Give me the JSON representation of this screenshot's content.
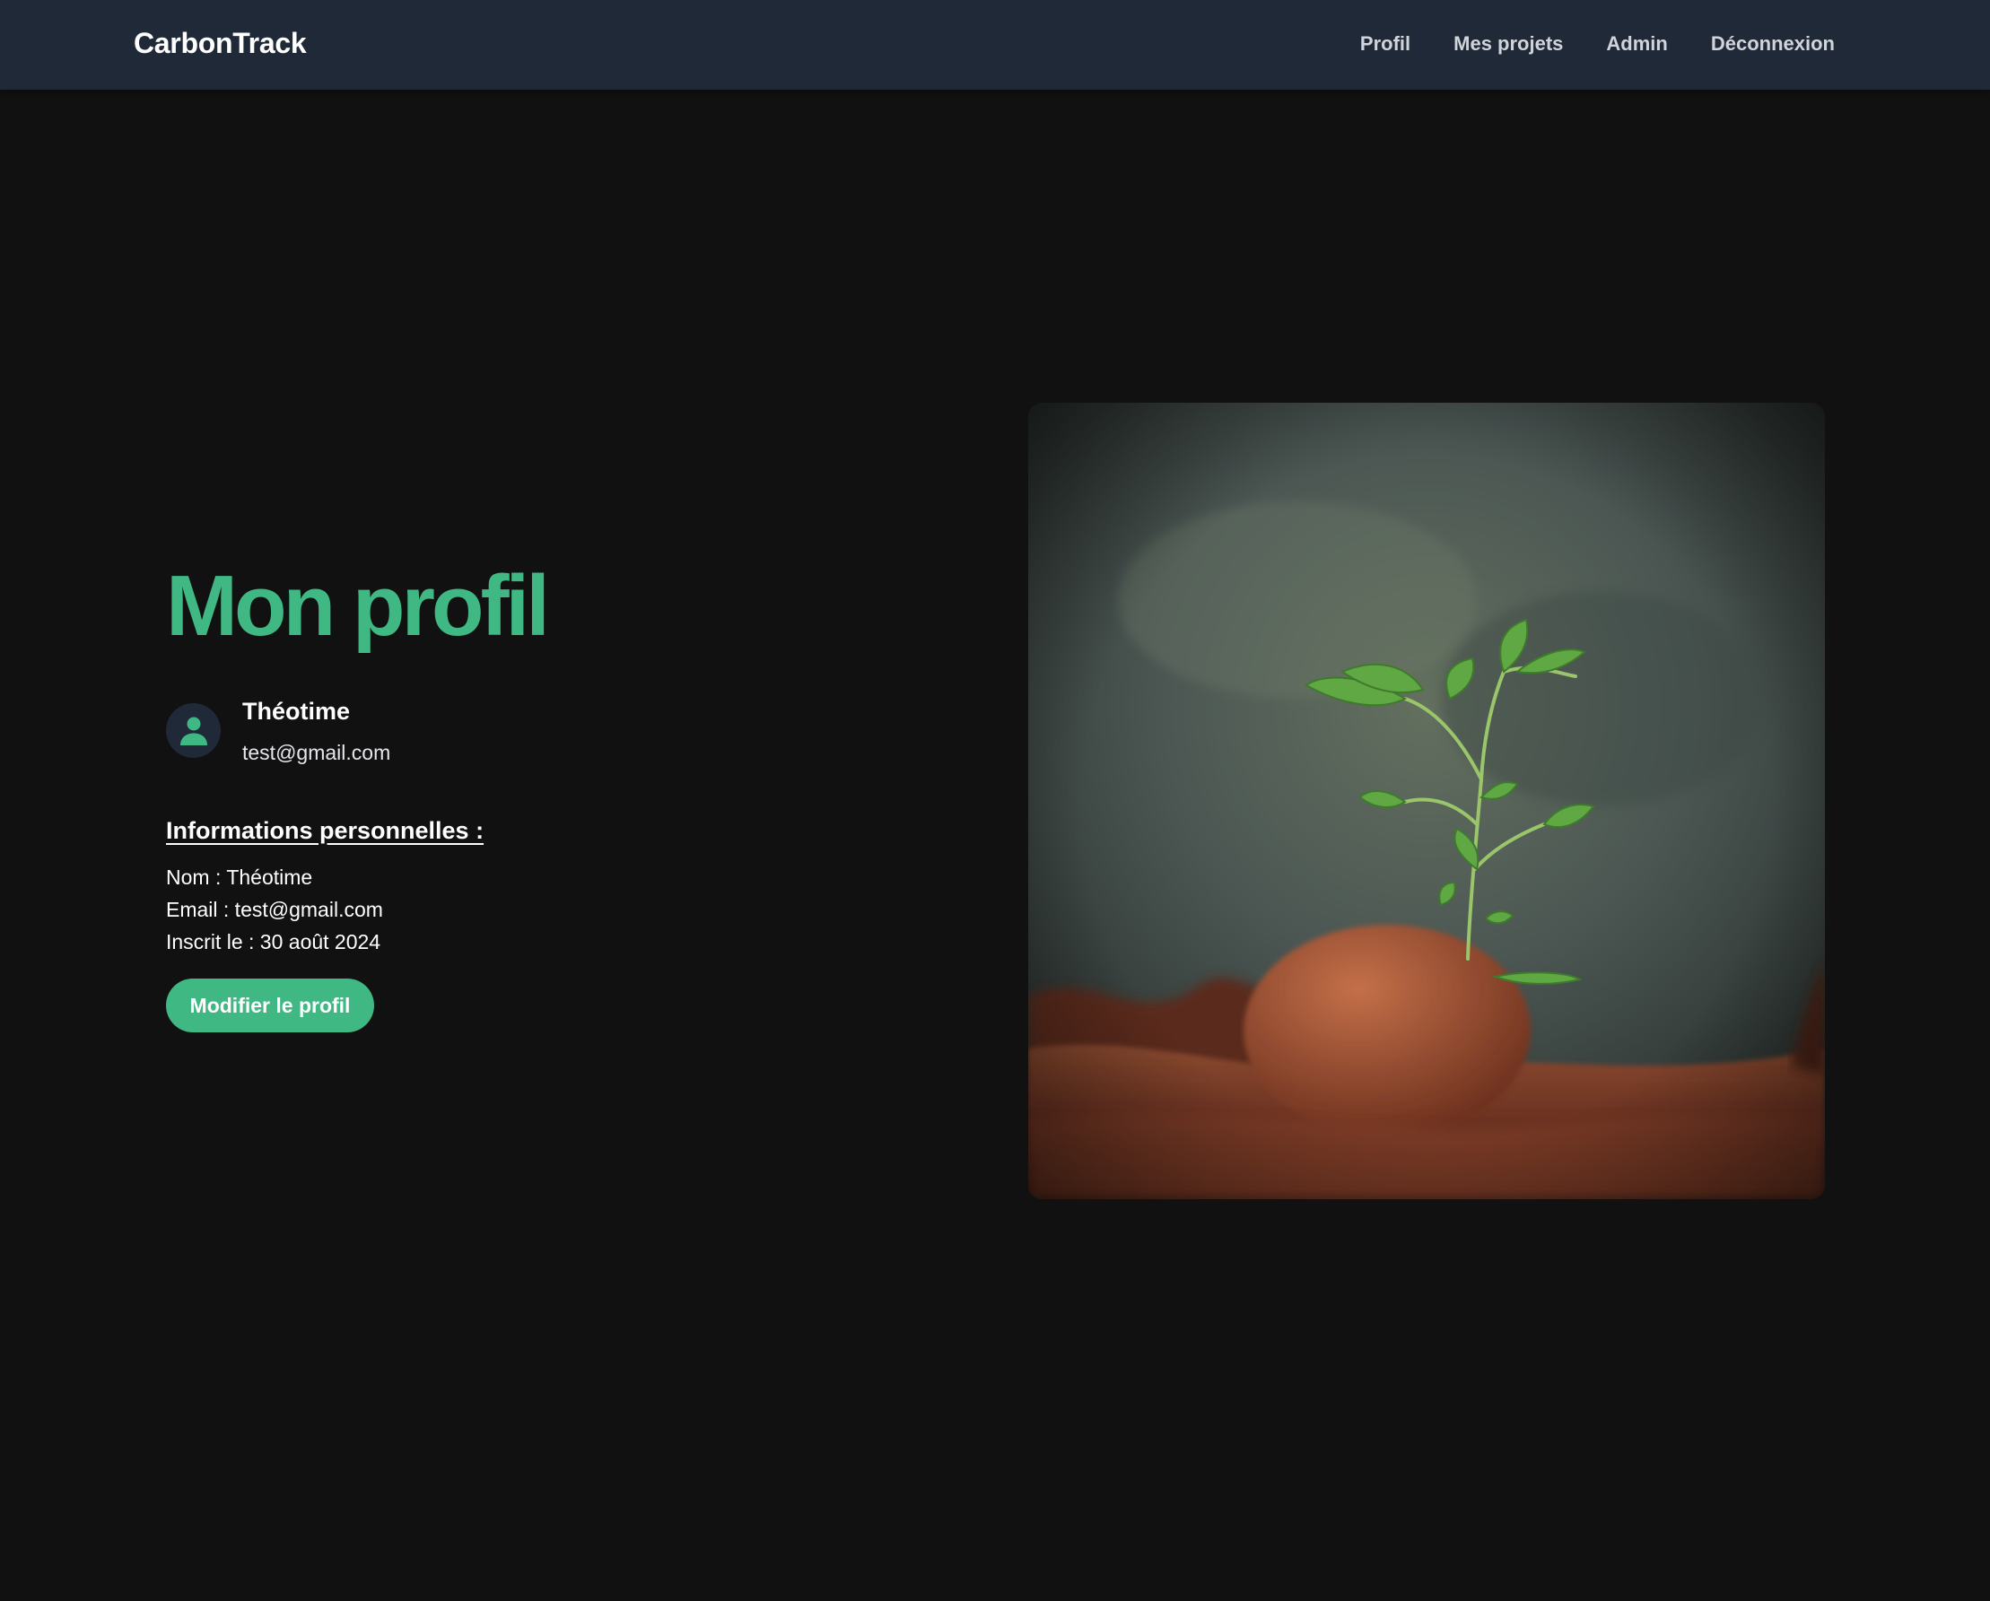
{
  "navbar": {
    "brand": "CarbonTrack",
    "links": [
      "Profil",
      "Mes projets",
      "Admin",
      "Déconnexion"
    ]
  },
  "profile": {
    "title": "Mon profil",
    "name": "Théotime",
    "email": "test@gmail.com"
  },
  "info": {
    "heading": "Informations personnelles :",
    "rows": [
      "Nom : Théotime",
      "Email : test@gmail.com",
      "Inscrit le : 30 août 2024"
    ]
  },
  "actions": {
    "edit_label": "Modifier le profil"
  },
  "colors": {
    "accent": "#3fb883",
    "navbar": "#1f2937",
    "background": "#111111"
  },
  "icons": {
    "avatar": "user-icon"
  }
}
